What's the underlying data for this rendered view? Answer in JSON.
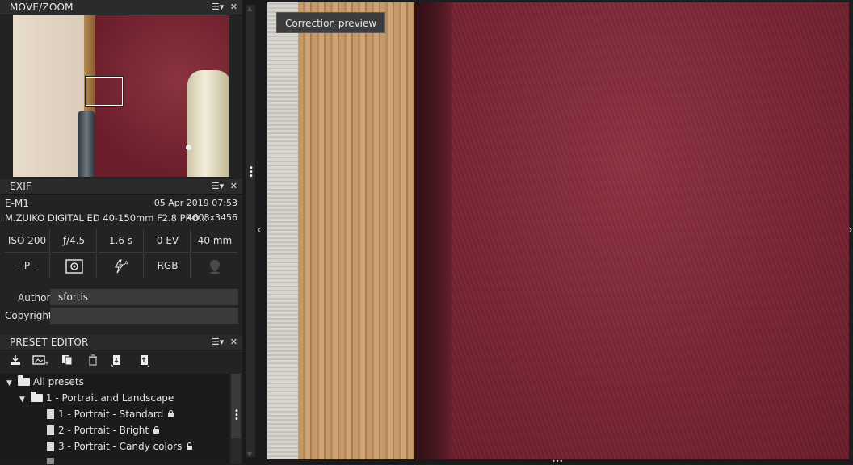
{
  "move_zoom": {
    "title": "MOVE/ZOOM",
    "menu_icon": "☰▾",
    "close_icon": "✕"
  },
  "exif": {
    "title": "EXIF",
    "menu_icon": "☰▾",
    "close_icon": "✕",
    "camera": "E-M1",
    "datetime": "05 Apr 2019 07:53",
    "lens": "M.ZUIKO DIGITAL ED 40-150mm F2.8 PRO...",
    "resolution": "4608x3456",
    "iso": "ISO 200",
    "aperture": "ƒ/4.5",
    "shutter": "1.6 s",
    "ev": "0 EV",
    "focal": "40 mm",
    "mode": "- P -",
    "colorspace": "RGB",
    "author_label": "Author",
    "author_value": "sfortis",
    "copyright_label": "Copyright",
    "copyright_value": ""
  },
  "preset_editor": {
    "title": "PRESET EDITOR",
    "menu_icon": "☰▾",
    "close_icon": "✕",
    "tree": [
      {
        "label": "All presets",
        "type": "folder",
        "level": 0
      },
      {
        "label": "1 - Portrait and Landscape",
        "type": "folder",
        "level": 1
      },
      {
        "label": "1 - Portrait - Standard",
        "type": "preset",
        "level": 2,
        "locked": true
      },
      {
        "label": "2 - Portrait - Bright",
        "type": "preset",
        "level": 2,
        "locked": true
      },
      {
        "label": "3 - Portrait - Candy colors",
        "type": "preset",
        "level": 2,
        "locked": true
      }
    ]
  },
  "viewer": {
    "badge": "Correction preview"
  },
  "colors": {
    "panel_bg": "#232323",
    "header_bg": "#2b2b2b",
    "accent_wall": "#7b2533"
  }
}
